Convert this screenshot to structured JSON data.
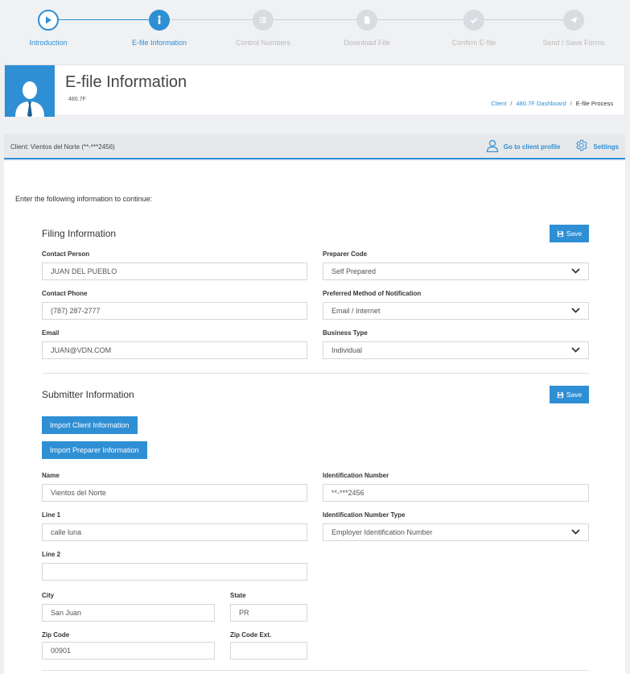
{
  "wizard": {
    "steps": [
      {
        "label": "Introduction"
      },
      {
        "label": "E-file Information"
      },
      {
        "label": "Control Numbers"
      },
      {
        "label": "Download File"
      },
      {
        "label": "Confirm E-file"
      },
      {
        "label": "Send / Save Forms"
      }
    ],
    "active_step": 1,
    "colors": {
      "active": "#2f8fd4",
      "inactive": "#d8dce0"
    }
  },
  "header": {
    "title": "E-file Information",
    "form_code": "480.7F",
    "breadcrumb": [
      {
        "label": "Client"
      },
      {
        "label": "480.7F Dashboard"
      },
      {
        "label": "E-file Process"
      }
    ],
    "breadcrumb_sep": "/"
  },
  "client_bar": {
    "client_text": "Client: Vientos del Norte (**-***2456)",
    "profile_link": "Go to client profile",
    "settings_link": "Settings"
  },
  "main": {
    "intro": "Enter the following information to continue:",
    "filing": {
      "title": "Filing Information",
      "save_label": "Save",
      "contact_person": {
        "label": "Contact Person",
        "value": "JUAN DEL PUEBLO"
      },
      "preparer_code": {
        "label": "Preparer Code",
        "value": "Self Prepared"
      },
      "contact_phone": {
        "label": "Contact Phone",
        "value": "(787) 287-2777"
      },
      "notification": {
        "label": "Preferred Method of Notification",
        "value": "Email / Internet"
      },
      "email": {
        "label": "Email",
        "value": "JUAN@VDN.COM"
      },
      "business_type": {
        "label": "Business Type",
        "value": "Individual"
      }
    },
    "submitter": {
      "title": "Submitter Information",
      "save_label": "Save",
      "import_client": "Import Client Information",
      "import_preparer": "Import Preparer Information",
      "name": {
        "label": "Name",
        "value": "Vientos del Norte"
      },
      "id_number": {
        "label": "Identification Number",
        "value": "**-***2456"
      },
      "line1": {
        "label": "Line 1",
        "value": "calle luna"
      },
      "id_type": {
        "label": "Identification Number Type",
        "value": "Employer Identification Number"
      },
      "line2": {
        "label": "Line 2",
        "value": ""
      },
      "city": {
        "label": "City",
        "value": "San Juan"
      },
      "state": {
        "label": "State",
        "value": "PR"
      },
      "zip": {
        "label": "Zip Code",
        "value": "00901"
      },
      "zip_ext": {
        "label": "Zip Code Ext.",
        "value": ""
      }
    }
  },
  "colors": {
    "accent": "#2f8fd4",
    "background": "#eef0f2"
  }
}
